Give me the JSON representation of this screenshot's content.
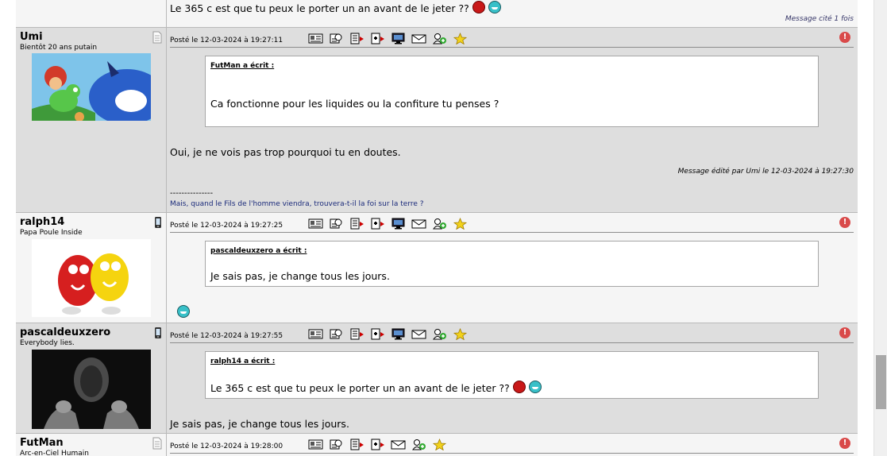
{
  "posts": [
    {
      "message": "Le 365 c est que tu peux le porter un an avant de le jeter ??",
      "cite_count": "Message cité 1 fois"
    },
    {
      "author": "Umi",
      "title": "Bientôt 20 ans putain",
      "date": "Posté le 12-03-2024 à 19:27:11",
      "quote": {
        "author": "FutMan a écrit :",
        "text": "Ca fonctionne pour les liquides ou la confiture tu penses ?"
      },
      "message": "Oui, je ne vois pas trop pourquoi tu en doutes.",
      "edited": "Message édité par Umi le 12-03-2024 à 19:27:30",
      "separator": "---------------",
      "signature": "Mais, quand le Fils de l'homme viendra, trouvera-t-il la foi sur la terre ?"
    },
    {
      "author": "ralph14",
      "title": "Papa Poule Inside",
      "date": "Posté le 12-03-2024 à 19:27:25",
      "quote": {
        "author": "pascaldeuxzero a écrit :",
        "text": "Je sais pas, je change tous les jours."
      }
    },
    {
      "author": "pascaldeuxzero",
      "title": "Everybody lies.",
      "date": "Posté le 12-03-2024 à 19:27:55",
      "quote": {
        "author": "ralph14 a écrit :",
        "text": "Le 365 c est que tu peux le porter un an avant de le jeter ??"
      },
      "message": "Je sais pas, je change tous les jours."
    },
    {
      "author": "FutMan",
      "title": "Arc-en-Ciel Humain",
      "date": "Posté le 12-03-2024 à 19:28:00"
    }
  ],
  "icons": {
    "profile": "profile-sheet-icon",
    "mobile": "mobile-phone-icon",
    "alert": "alert-moderator-icon",
    "toolbar": [
      "profile-card-icon",
      "quick-quote-icon",
      "quote-icon",
      "multi-quote-icon",
      "pc-icon",
      "private-message-icon",
      "add-friend-icon",
      "favorite-star-icon"
    ]
  },
  "colors": {
    "post_odd": "#f5f5f5",
    "post_even": "#dedede",
    "signature": "#1a2a7a",
    "alert": "#d94a4a"
  }
}
